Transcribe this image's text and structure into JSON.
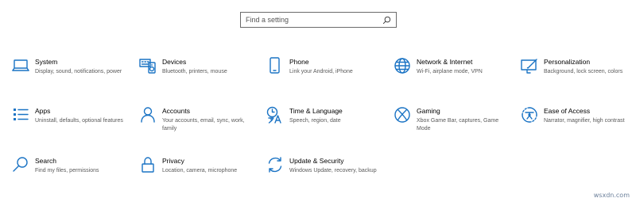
{
  "search": {
    "placeholder": "Find a setting",
    "icon": "search-icon"
  },
  "tiles": [
    {
      "title": "System",
      "desc": "Display, sound, notifications, power",
      "icon": "laptop-icon"
    },
    {
      "title": "Devices",
      "desc": "Bluetooth, printers, mouse",
      "icon": "keyboard-speaker-icon"
    },
    {
      "title": "Phone",
      "desc": "Link your Android, iPhone",
      "icon": "phone-icon"
    },
    {
      "title": "Network & Internet",
      "desc": "Wi-Fi, airplane mode, VPN",
      "icon": "globe-icon"
    },
    {
      "title": "Personalization",
      "desc": "Background, lock screen, colors",
      "icon": "paint-icon"
    },
    {
      "title": "Apps",
      "desc": "Uninstall, defaults, optional features",
      "icon": "apps-list-icon"
    },
    {
      "title": "Accounts",
      "desc": "Your accounts, email, sync, work, family",
      "icon": "person-icon"
    },
    {
      "title": "Time & Language",
      "desc": "Speech, region, date",
      "icon": "time-language-icon"
    },
    {
      "title": "Gaming",
      "desc": "Xbox Game Bar, captures, Game Mode",
      "icon": "xbox-icon"
    },
    {
      "title": "Ease of Access",
      "desc": "Narrator, magnifier, high contrast",
      "icon": "ease-of-access-icon"
    },
    {
      "title": "Search",
      "desc": "Find my files, permissions",
      "icon": "magnifier-icon"
    },
    {
      "title": "Privacy",
      "desc": "Location, camera, microphone",
      "icon": "lock-icon"
    },
    {
      "title": "Update & Security",
      "desc": "Windows Update, recovery, backup",
      "icon": "sync-arrows-icon"
    }
  ],
  "watermark": "wsxdn.com",
  "colors": {
    "accent": "#1a73c4",
    "desc_text": "#5a5a5a",
    "border": "#6b6b6b"
  }
}
